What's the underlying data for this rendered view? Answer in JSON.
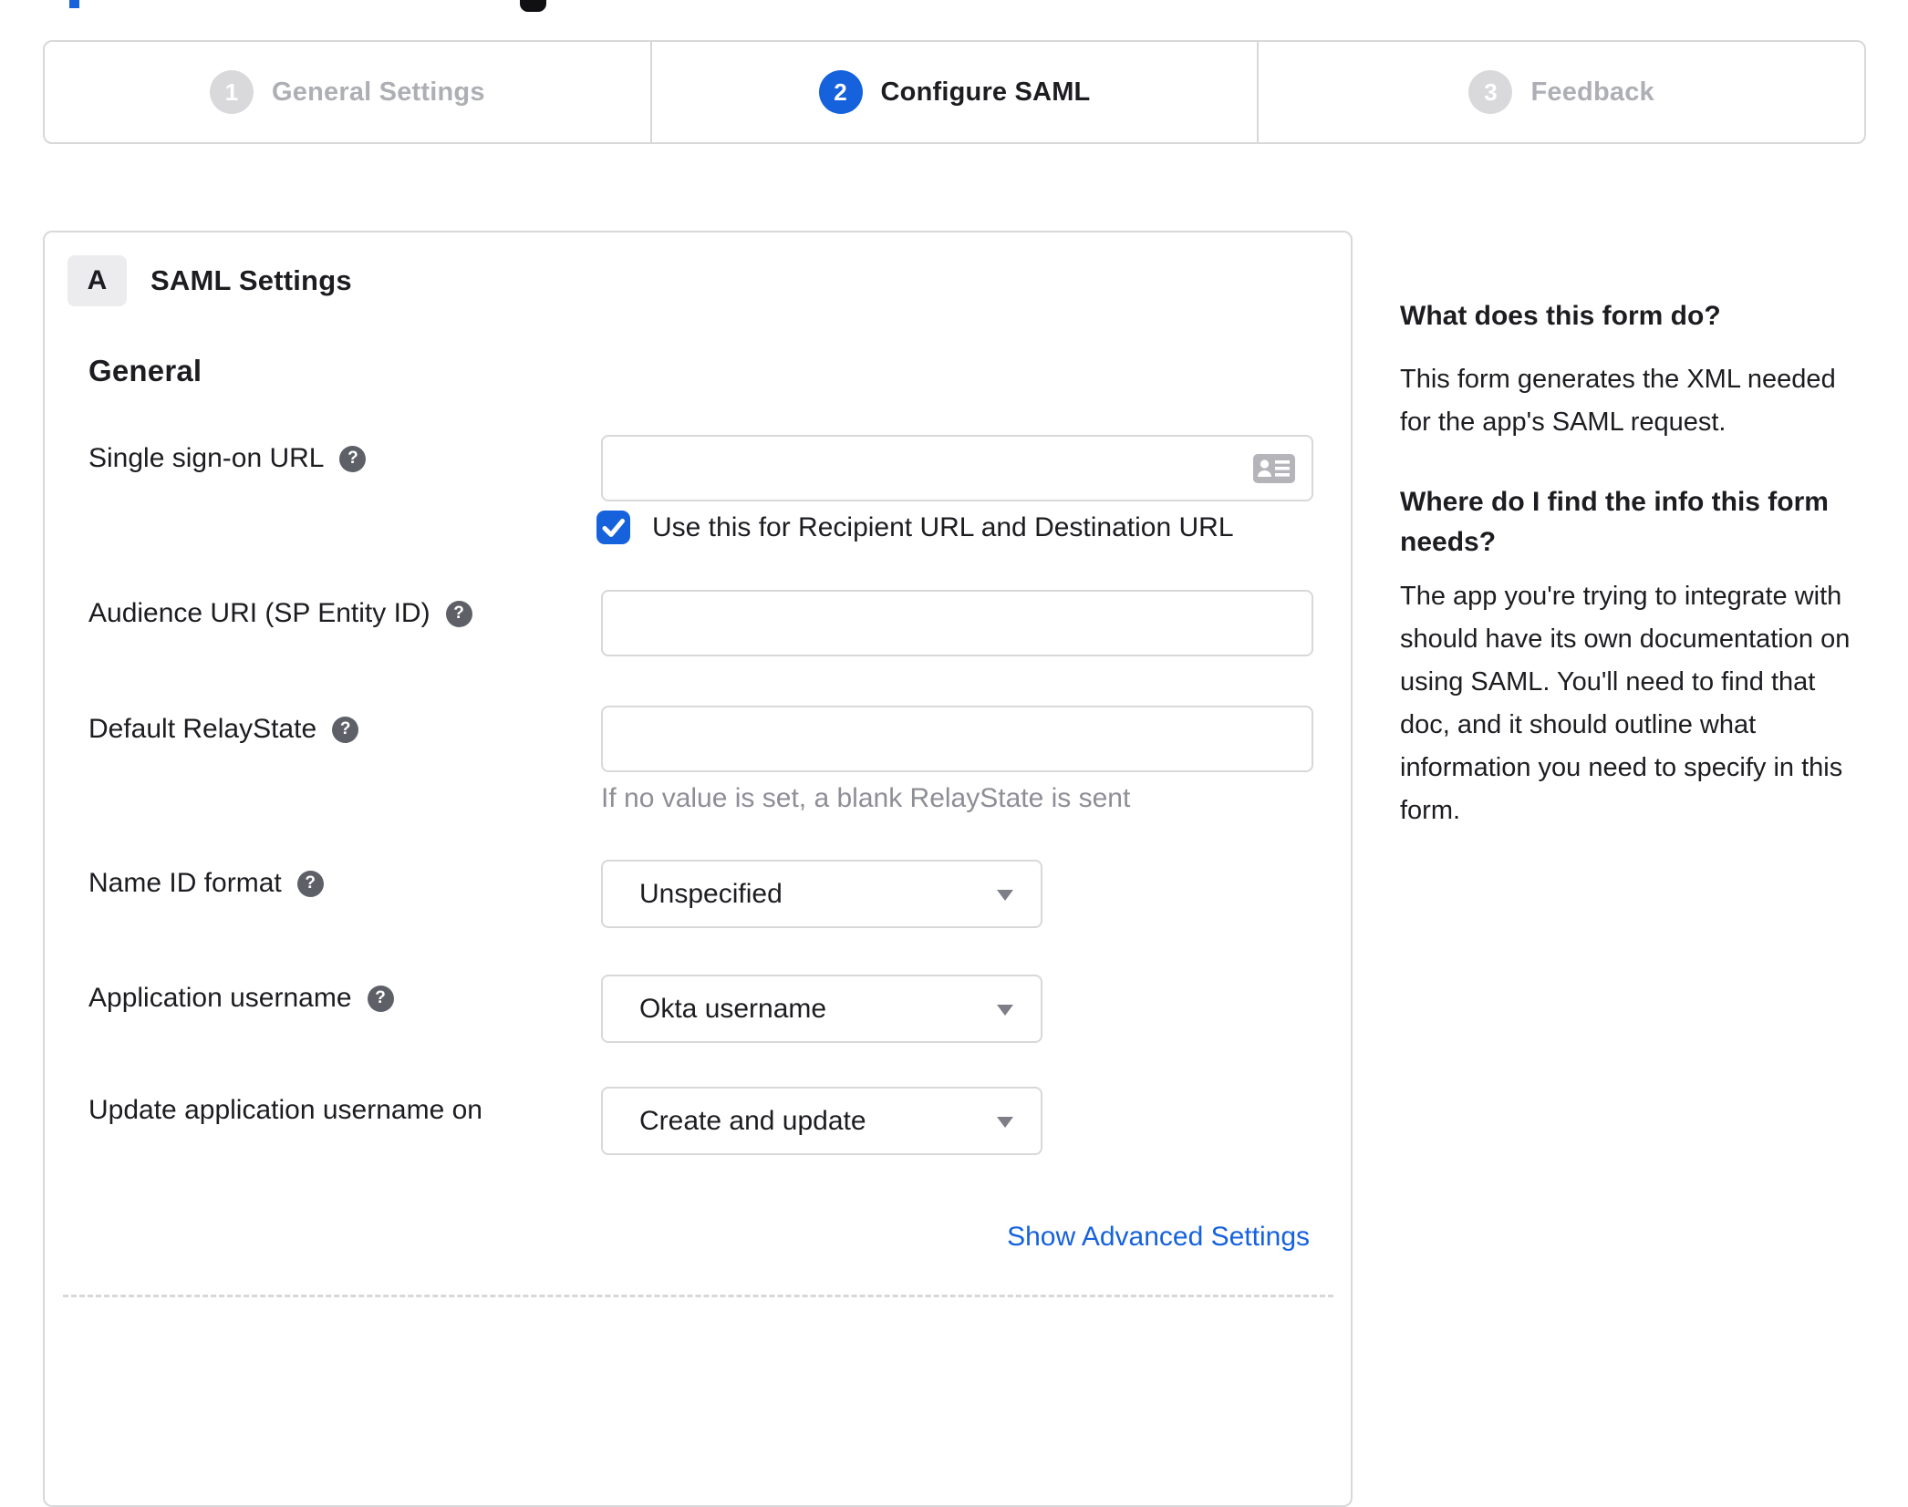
{
  "colors": {
    "accent": "#1662dd",
    "text": "#1d1d21",
    "inactive_step": "#aeafb4",
    "border": "#d8d8da",
    "hint": "#8e8e96",
    "help_icon_bg": "#5d6067",
    "card_icon_gray": "#b4b4b9"
  },
  "stepper": {
    "steps": [
      {
        "number": "1",
        "label": "General Settings",
        "state": "inactive"
      },
      {
        "number": "2",
        "label": "Configure SAML",
        "state": "active"
      },
      {
        "number": "3",
        "label": "Feedback",
        "state": "inactive"
      }
    ]
  },
  "panel": {
    "badge": "A",
    "title": "SAML Settings",
    "section_heading": "General",
    "fields": [
      {
        "label": "Single sign-on URL",
        "has_help": true,
        "type": "text",
        "value": "",
        "trailing_icon": "contact-card-icon",
        "checkbox": {
          "checked": true,
          "label": "Use this for Recipient URL and Destination URL"
        }
      },
      {
        "label": "Audience URI (SP Entity ID)",
        "has_help": true,
        "type": "text",
        "value": ""
      },
      {
        "label": "Default RelayState",
        "has_help": true,
        "type": "text",
        "value": "",
        "hint": "If no value is set, a blank RelayState is sent"
      },
      {
        "label": "Name ID format",
        "has_help": true,
        "type": "select",
        "value": "Unspecified"
      },
      {
        "label": "Application username",
        "has_help": true,
        "type": "select",
        "value": "Okta username"
      },
      {
        "label": "Update application username on",
        "has_help": false,
        "type": "select",
        "value": "Create and update"
      }
    ],
    "advanced_link": "Show Advanced Settings"
  },
  "sidebar": {
    "heading1": "What does this form do?",
    "para1": "This form generates the XML needed for the app's SAML request.",
    "heading2": "Where do I find the info this form needs?",
    "para2": "The app you're trying to integrate with should have its own documentation on using SAML. You'll need to find that doc, and it should outline what information you need to specify in this form."
  }
}
